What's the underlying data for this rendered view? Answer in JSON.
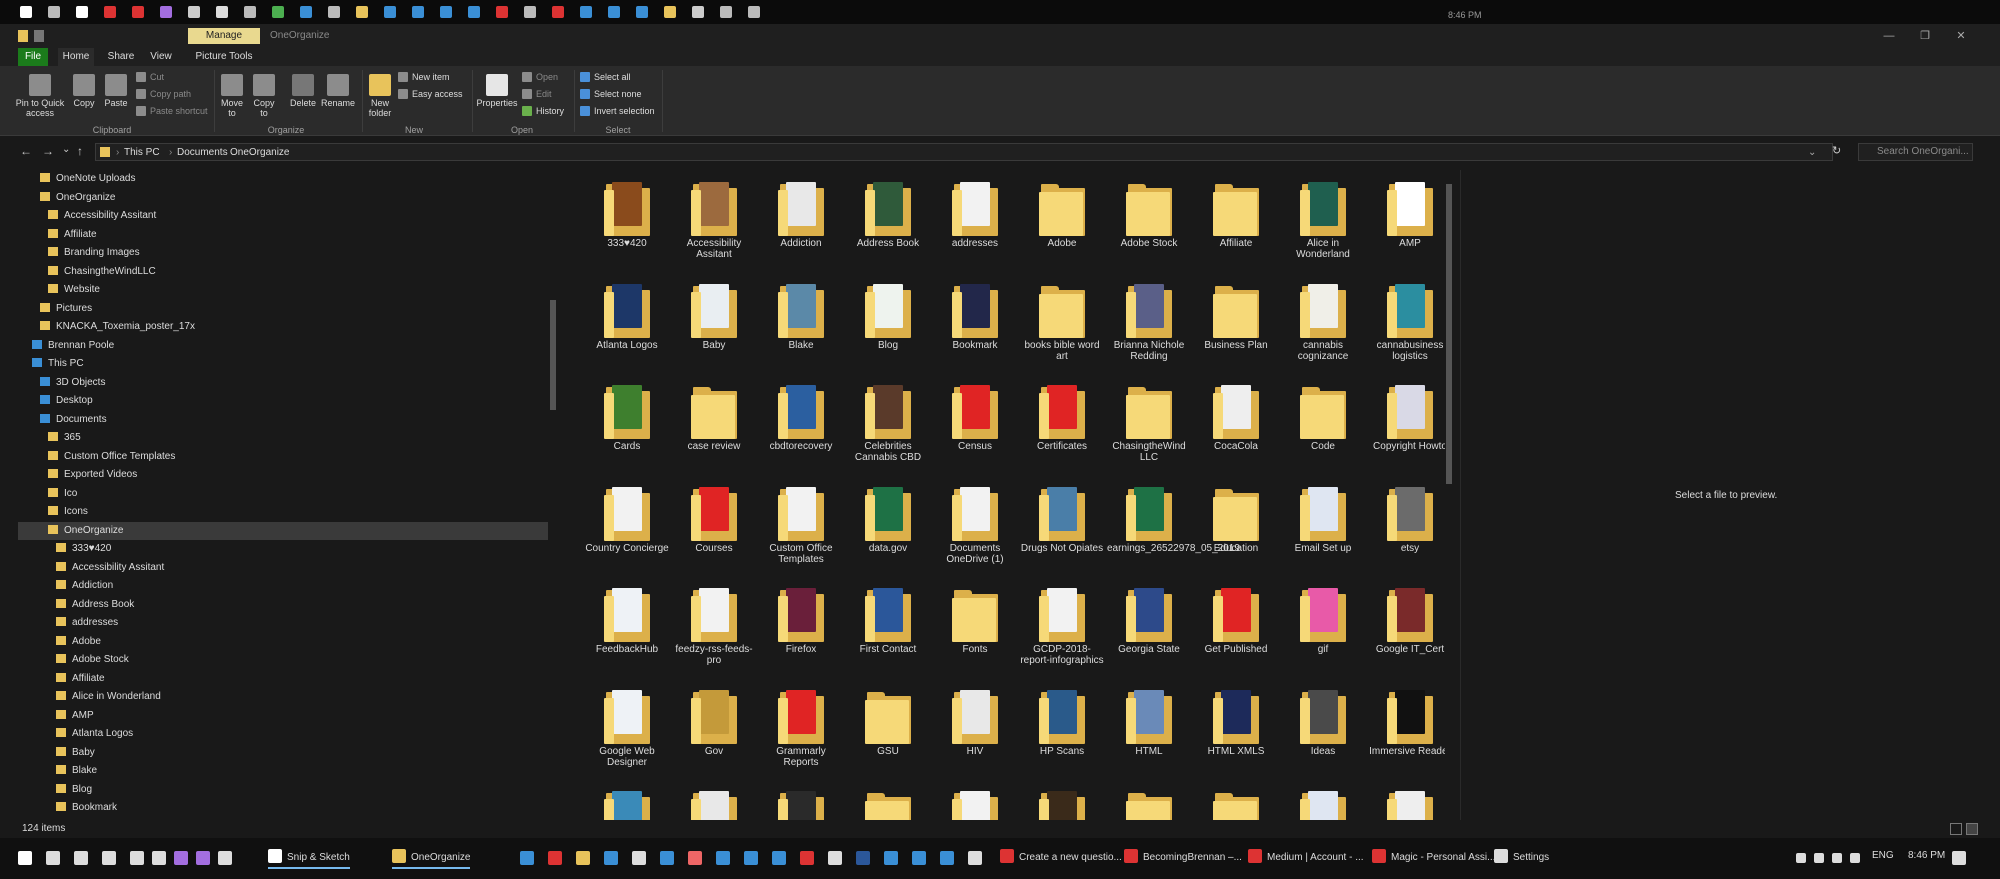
{
  "titlebar": {
    "manage_tab": "Manage",
    "window_title": "OneOrganize",
    "minimize": "—",
    "maximize": "❐",
    "close": "✕"
  },
  "ribbon": {
    "tabs": {
      "file": "File",
      "home": "Home",
      "share": "Share",
      "view": "View",
      "picture_tools": "Picture Tools"
    },
    "clipboard": {
      "pin": "Pin to Quick access",
      "copy": "Copy",
      "paste": "Paste",
      "cut": "Cut",
      "copy_path": "Copy path",
      "paste_shortcut": "Paste shortcut",
      "label": "Clipboard"
    },
    "organize": {
      "move_to": "Move to",
      "copy_to": "Copy to",
      "delete": "Delete",
      "rename": "Rename",
      "label": "Organize"
    },
    "new": {
      "new_folder": "New folder",
      "new_item": "New item",
      "easy_access": "Easy access",
      "label": "New"
    },
    "open": {
      "properties": "Properties",
      "open": "Open",
      "edit": "Edit",
      "history": "History",
      "label": "Open"
    },
    "select": {
      "select_all": "Select all",
      "select_none": "Select none",
      "invert": "Invert selection",
      "label": "Select"
    }
  },
  "address": {
    "back": "←",
    "forward": "→",
    "recent": "⌄",
    "up": "↑",
    "crumbs": [
      "This PC",
      "Documents",
      "OneOrganize"
    ],
    "sep": "›",
    "search_placeholder": "Search OneOrgani...",
    "refresh": "↻",
    "dropdown": "⌄"
  },
  "tree": [
    {
      "label": "OneNote Uploads",
      "indent": 1,
      "icon": "folder"
    },
    {
      "label": "OneOrganize",
      "indent": 1,
      "icon": "folder"
    },
    {
      "label": "Accessibility Assitant",
      "indent": 2,
      "icon": "folder"
    },
    {
      "label": "Affiliate",
      "indent": 2,
      "icon": "folder"
    },
    {
      "label": "Branding Images",
      "indent": 2,
      "icon": "folder"
    },
    {
      "label": "ChasingtheWindLLC",
      "indent": 2,
      "icon": "folder"
    },
    {
      "label": "Website",
      "indent": 2,
      "icon": "folder"
    },
    {
      "label": "Pictures",
      "indent": 1,
      "icon": "folder"
    },
    {
      "label": "KNACKA_Toxemia_poster_17x",
      "indent": 1,
      "icon": "folder"
    },
    {
      "label": "Brennan Poole",
      "indent": 0,
      "icon": "user"
    },
    {
      "label": "This PC",
      "indent": 0,
      "icon": "pc"
    },
    {
      "label": "3D Objects",
      "indent": 1,
      "icon": "pc"
    },
    {
      "label": "Desktop",
      "indent": 1,
      "icon": "pc"
    },
    {
      "label": "Documents",
      "indent": 1,
      "icon": "pc"
    },
    {
      "label": "365",
      "indent": 2,
      "icon": "folder"
    },
    {
      "label": "Custom Office Templates",
      "indent": 2,
      "icon": "folder"
    },
    {
      "label": "Exported Videos",
      "indent": 2,
      "icon": "folder"
    },
    {
      "label": "Ico",
      "indent": 2,
      "icon": "folder"
    },
    {
      "label": "Icons",
      "indent": 2,
      "icon": "folder"
    },
    {
      "label": "OneOrganize",
      "indent": 2,
      "icon": "folder",
      "selected": true
    },
    {
      "label": "333♥420",
      "indent": 3,
      "icon": "folder"
    },
    {
      "label": "Accessibility Assitant",
      "indent": 3,
      "icon": "folder"
    },
    {
      "label": "Addiction",
      "indent": 3,
      "icon": "folder"
    },
    {
      "label": "Address Book",
      "indent": 3,
      "icon": "folder"
    },
    {
      "label": "addresses",
      "indent": 3,
      "icon": "folder"
    },
    {
      "label": "Adobe",
      "indent": 3,
      "icon": "folder"
    },
    {
      "label": "Adobe Stock",
      "indent": 3,
      "icon": "folder"
    },
    {
      "label": "Affiliate",
      "indent": 3,
      "icon": "folder"
    },
    {
      "label": "Alice in Wonderland",
      "indent": 3,
      "icon": "folder"
    },
    {
      "label": "AMP",
      "indent": 3,
      "icon": "folder"
    },
    {
      "label": "Atlanta Logos",
      "indent": 3,
      "icon": "folder"
    },
    {
      "label": "Baby",
      "indent": 3,
      "icon": "folder"
    },
    {
      "label": "Blake",
      "indent": 3,
      "icon": "folder"
    },
    {
      "label": "Blog",
      "indent": 3,
      "icon": "folder"
    },
    {
      "label": "Bookmark",
      "indent": 3,
      "icon": "folder"
    }
  ],
  "files": [
    {
      "name": "333♥420",
      "doc": "#8a4b1c"
    },
    {
      "name": "Accessibility Assitant",
      "doc": "#9c6a3e"
    },
    {
      "name": "Addiction",
      "doc": "#e8e8e8"
    },
    {
      "name": "Address Book",
      "doc": "#2f5a3a"
    },
    {
      "name": "addresses",
      "doc": "#f2f2f2"
    },
    {
      "name": "Adobe",
      "doc": ""
    },
    {
      "name": "Adobe Stock",
      "doc": ""
    },
    {
      "name": "Affiliate",
      "doc": ""
    },
    {
      "name": "Alice in Wonderland",
      "doc": "#1f5f4f"
    },
    {
      "name": "AMP",
      "doc": "#ffffff"
    },
    {
      "name": "Atlanta Logos",
      "doc": "#1d3768"
    },
    {
      "name": "Baby",
      "doc": "#e9eef2"
    },
    {
      "name": "Blake",
      "doc": "#5b89a8"
    },
    {
      "name": "Blog",
      "doc": "#eef3ee"
    },
    {
      "name": "Bookmark",
      "doc": "#22274a"
    },
    {
      "name": "books bible word art",
      "doc": ""
    },
    {
      "name": "Brianna Nichole Redding",
      "doc": "#5a5f88"
    },
    {
      "name": "Business Plan",
      "doc": ""
    },
    {
      "name": "cannabis cognizance",
      "doc": "#f0efe8"
    },
    {
      "name": "cannabusiness logistics",
      "doc": "#2b8ea0"
    },
    {
      "name": "Cards",
      "doc": "#3e7f2e"
    },
    {
      "name": "case review",
      "doc": ""
    },
    {
      "name": "cbdtorecovery",
      "doc": "#2b5fa0"
    },
    {
      "name": "Celebrities Cannabis CBD",
      "doc": "#5a3a2a"
    },
    {
      "name": "Census",
      "doc": "#e02424"
    },
    {
      "name": "Certificates",
      "doc": "#e02424"
    },
    {
      "name": "ChasingtheWind LLC",
      "doc": ""
    },
    {
      "name": "CocaCola",
      "doc": "#eeeeee"
    },
    {
      "name": "Code",
      "doc": ""
    },
    {
      "name": "Copyright Howto",
      "doc": "#d9d9e6"
    },
    {
      "name": "Country Concierge",
      "doc": "#f2f2f2"
    },
    {
      "name": "Courses",
      "doc": "#e02424"
    },
    {
      "name": "Custom Office Templates",
      "doc": "#f2f2f2"
    },
    {
      "name": "data.gov",
      "doc": "#1e7145"
    },
    {
      "name": "Documents OneDrive (1)",
      "doc": "#f2f2f2"
    },
    {
      "name": "Drugs Not Opiates",
      "doc": "#4a7ea8"
    },
    {
      "name": "earnings_26522978_05_2019",
      "doc": "#1e7145"
    },
    {
      "name": "Education",
      "doc": ""
    },
    {
      "name": "Email Set up",
      "doc": "#dfe6f2"
    },
    {
      "name": "etsy",
      "doc": "#6b6b6b"
    },
    {
      "name": "FeedbackHub",
      "doc": "#eef2f6"
    },
    {
      "name": "feedzy-rss-feeds-pro",
      "doc": "#f2f2f2"
    },
    {
      "name": "Firefox",
      "doc": "#6a1f3a"
    },
    {
      "name": "First Contact",
      "doc": "#2b579a"
    },
    {
      "name": "Fonts",
      "doc": ""
    },
    {
      "name": "GCDP-2018-report-infographics",
      "doc": "#f2f2f2"
    },
    {
      "name": "Georgia State",
      "doc": "#2d4a8a"
    },
    {
      "name": "Get Published",
      "doc": "#e02424"
    },
    {
      "name": "gif",
      "doc": "#e85aa8"
    },
    {
      "name": "Google IT_Cert",
      "doc": "#7a2a2a"
    },
    {
      "name": "Google Web Designer",
      "doc": "#eef2f6"
    },
    {
      "name": "Gov",
      "doc": "#c49a3a"
    },
    {
      "name": "Grammarly Reports",
      "doc": "#e02424"
    },
    {
      "name": "GSU",
      "doc": ""
    },
    {
      "name": "HIV",
      "doc": "#e8e8e8"
    },
    {
      "name": "HP Scans",
      "doc": "#2a5a8a"
    },
    {
      "name": "HTML",
      "doc": "#6a8ab8"
    },
    {
      "name": "HTML XMLS",
      "doc": "#1d2a5a"
    },
    {
      "name": "Ideas",
      "doc": "#4a4a4a"
    },
    {
      "name": "Immersive Reader",
      "doc": "#111111"
    },
    {
      "name": "",
      "doc": "#3a8ab8"
    },
    {
      "name": "",
      "doc": "#e8e8e8"
    },
    {
      "name": "",
      "doc": "#2a2a2a"
    },
    {
      "name": "",
      "doc": ""
    },
    {
      "name": "",
      "doc": "#f2f2f2"
    },
    {
      "name": "",
      "doc": "#3a2a1a"
    },
    {
      "name": "",
      "doc": ""
    },
    {
      "name": "",
      "doc": ""
    },
    {
      "name": "",
      "doc": "#dfe6f2"
    },
    {
      "name": "",
      "doc": "#eeeeee"
    }
  ],
  "preview_text": "Select a file to preview.",
  "status": {
    "count": "124 items"
  },
  "taskbar": {
    "apps": [
      {
        "label": "Snip & Sketch",
        "color": "#ffffff"
      },
      {
        "label": "OneOrganize",
        "color": "#e8c35b"
      },
      {
        "label": "Create a new questio...",
        "color": "#d33"
      },
      {
        "label": "BecomingBrennan –...",
        "color": "#d33"
      },
      {
        "label": "Medium | Account - ...",
        "color": "#d33"
      },
      {
        "label": "Magic - Personal Assi...",
        "color": "#d33"
      },
      {
        "label": "Settings",
        "color": "#ddd"
      }
    ],
    "lang": "ENG",
    "time": "8:46 PM"
  },
  "topstrip": {
    "clock": "8:46 PM"
  }
}
